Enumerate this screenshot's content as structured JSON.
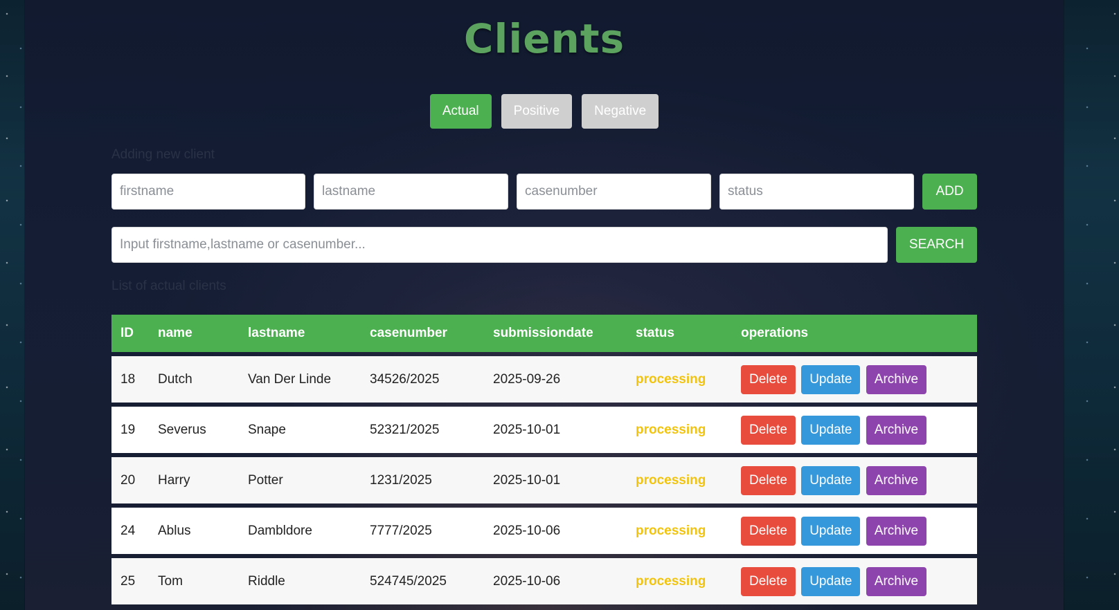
{
  "page": {
    "title": "Clients"
  },
  "tabs": [
    {
      "label": "Actual",
      "active": true
    },
    {
      "label": "Positive",
      "active": false
    },
    {
      "label": "Negative",
      "active": false
    }
  ],
  "add_form": {
    "section_label": "Adding new client",
    "firstname_placeholder": "firstname",
    "lastname_placeholder": "lastname",
    "casenumber_placeholder": "casenumber",
    "status_placeholder": "status",
    "add_label": "ADD"
  },
  "search": {
    "placeholder": "Input firstname,lastname or casenumber...",
    "button_label": "SEARCH"
  },
  "list": {
    "section_label": "List of actual clients",
    "columns": [
      "ID",
      "name",
      "lastname",
      "casenumber",
      "submissiondate",
      "status",
      "operations"
    ],
    "rows": [
      {
        "id": "18",
        "name": "Dutch",
        "lastname": "Van Der Linde",
        "casenumber": "34526/2025",
        "submissiondate": "2025-09-26",
        "status": "processing"
      },
      {
        "id": "19",
        "name": "Severus",
        "lastname": "Snape",
        "casenumber": "52321/2025",
        "submissiondate": "2025-10-01",
        "status": "processing"
      },
      {
        "id": "20",
        "name": "Harry",
        "lastname": "Potter",
        "casenumber": "1231/2025",
        "submissiondate": "2025-10-01",
        "status": "processing"
      },
      {
        "id": "24",
        "name": "Ablus",
        "lastname": "Dambldore",
        "casenumber": "7777/2025",
        "submissiondate": "2025-10-06",
        "status": "processing"
      },
      {
        "id": "25",
        "name": "Tom",
        "lastname": "Riddle",
        "casenumber": "524745/2025",
        "submissiondate": "2025-10-06",
        "status": "processing"
      }
    ],
    "operations": {
      "delete": "Delete",
      "update": "Update",
      "archive": "Archive"
    }
  },
  "colors": {
    "accent_green": "#4caf50",
    "title_green": "#5ba35e",
    "status_processing": "#f1c40f",
    "delete_red": "#e74c3c",
    "update_blue": "#3498db",
    "archive_purple": "#8e44ad",
    "tab_inactive": "#cfcfcf"
  }
}
